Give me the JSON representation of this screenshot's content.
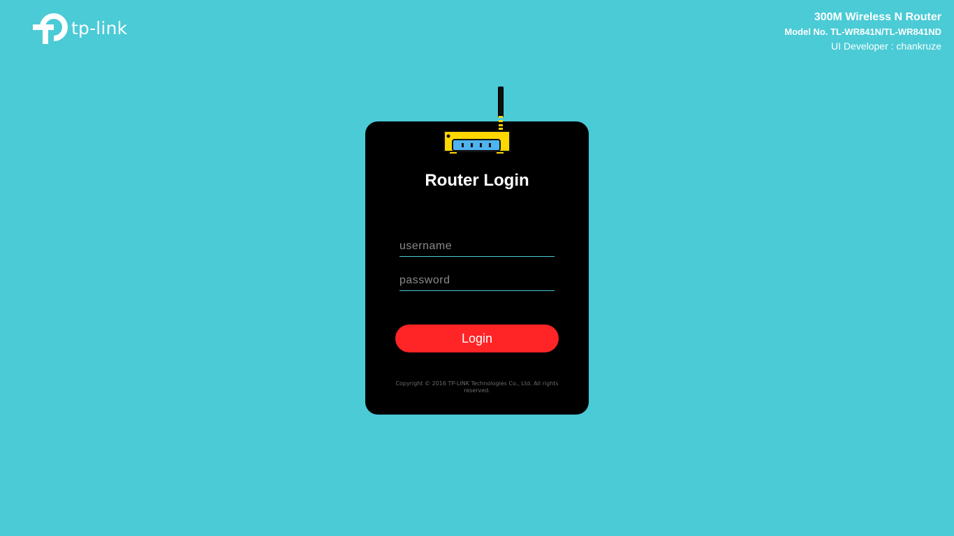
{
  "brand": {
    "logo_text": "tp-link",
    "logo_icon": "tp-link-logo-icon"
  },
  "header": {
    "product": "300M Wireless N Router",
    "model": "Model No. TL-WR841N/TL-WR841ND",
    "developer": "UI Developer : chankruze"
  },
  "login": {
    "title": "Router Login",
    "username_placeholder": "username",
    "password_placeholder": "password",
    "button_label": "Login",
    "router_icon": "router-icon"
  },
  "footer": {
    "copyright": "Copyright © 2016 TP-LINK Technologies Co., Ltd. All rights reserved."
  },
  "colors": {
    "background": "#4acbd6",
    "card": "#000000",
    "button": "#ff2426",
    "accent_yellow": "#ffd700"
  }
}
